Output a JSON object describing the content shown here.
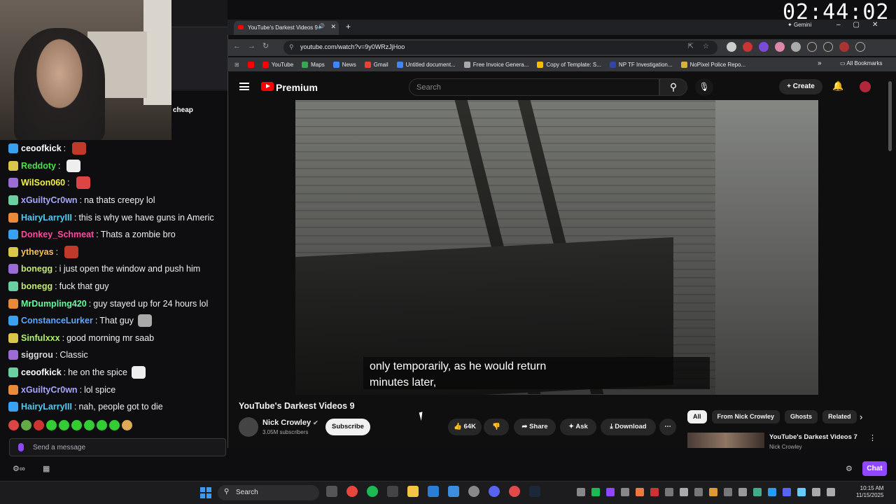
{
  "overlay": {
    "timer": "02:44:02",
    "side_text": "cheap"
  },
  "chat": {
    "messages": [
      {
        "user": "ceoofkick",
        "text": "",
        "color": "#ffffff"
      },
      {
        "user": "Reddoty",
        "text": "",
        "color": "#4ce04c"
      },
      {
        "user": "WilSon060",
        "text": "",
        "color": "#f0f04a"
      },
      {
        "user": "xGuiltyCr0wn",
        "text": "na thats creepy lol",
        "color": "#a6a6ff"
      },
      {
        "user": "HairyLarryIII",
        "text": "this is why we have guns in Americ",
        "color": "#54c8f0"
      },
      {
        "user": "Donkey_Schmeat",
        "text": "Thats a zombie bro",
        "color": "#ff4aa0"
      },
      {
        "user": "ytheyas",
        "text": "",
        "color": "#f5c15c"
      },
      {
        "user": "bonegg",
        "text": "i just open the window and push him",
        "color": "#c4e870"
      },
      {
        "user": "bonegg",
        "text": "fuck that guy",
        "color": "#c4e870"
      },
      {
        "user": "MrDumpling420",
        "text": "guy stayed up for 24 hours lol",
        "color": "#5cff9e"
      },
      {
        "user": "ConstanceLurker",
        "text": "That guy",
        "color": "#5fa6ff"
      },
      {
        "user": "Sinfulxxx",
        "text": "good morning mr saab",
        "color": "#b0f070"
      },
      {
        "user": "siggrou",
        "text": "Classic",
        "color": "#d8d8d8"
      },
      {
        "user": "ceoofkick",
        "text": "he on the spice",
        "color": "#ffffff"
      },
      {
        "user": "xGuiltyCr0wn",
        "text": "lol spice",
        "color": "#a6a6ff"
      },
      {
        "user": "HairyLarryIII",
        "text": "nah, people got to die",
        "color": "#54c8f0"
      }
    ],
    "input_placeholder": "Send a message",
    "chat_button": "Chat"
  },
  "browser": {
    "tab_title": "YouTube's Darkest Videos 9",
    "new_tab": "+",
    "gemini": "Gemini",
    "url": "youtube.com/watch?v=9y0WRzJjHoo",
    "bookmarks": [
      "YouTube",
      "Maps",
      "News",
      "Gmail",
      "Untitled document...",
      "Free Invoice Genera...",
      "Copy of Template: S...",
      "NP TF Investigation...",
      "NoPixel Police Repo..."
    ],
    "all_bookmarks": "All Bookmarks"
  },
  "youtube": {
    "logo_text": "Premium",
    "search_placeholder": "Search",
    "create": "Create",
    "caption_line1": "only temporarily, as he would return",
    "caption_line2": "minutes later,",
    "video_title": "YouTube's Darkest Videos 9",
    "channel": "Nick Crowley",
    "subscribers": "3.05M subscribers",
    "subscribe": "Subscribe",
    "likes": "64K",
    "share": "Share",
    "ask": "Ask",
    "download": "Download",
    "chips": [
      "All",
      "From Nick Crowley",
      "Ghosts",
      "Related"
    ],
    "reco_title": "YouTube's Darkest Videos 7",
    "reco_channel": "Nick Crowley"
  },
  "taskbar": {
    "search": "Search",
    "time": "10:15 AM",
    "date": "11/15/2025"
  }
}
